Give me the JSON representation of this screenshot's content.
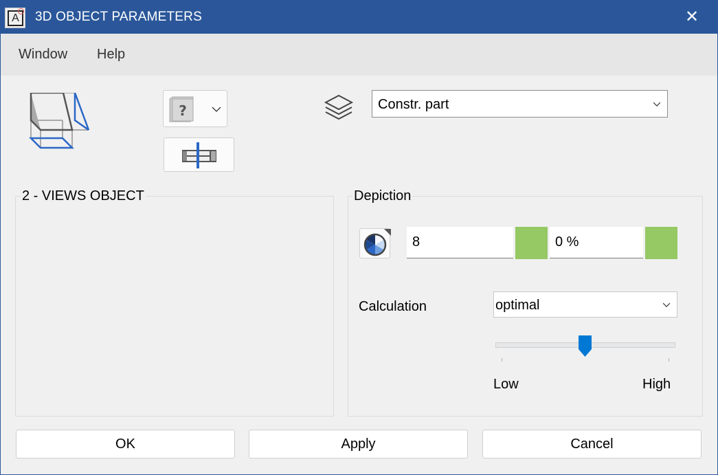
{
  "titlebar": {
    "title": "3D OBJECT PARAMETERS",
    "app_icon_letter": "A",
    "close_glyph": "✕"
  },
  "menu": {
    "items": [
      {
        "label": "Window"
      },
      {
        "label": "Help"
      }
    ]
  },
  "toolbar": {
    "unknown_type_glyph": "?",
    "layer_select": {
      "value": "Constr. part"
    }
  },
  "views_group": {
    "title": "2 - VIEWS OBJECT"
  },
  "depiction": {
    "title": "Depiction",
    "value_1": "8",
    "value_2": "0 %",
    "swatch_color": "#96c864",
    "calculation_label": "Calculation",
    "calculation_select": {
      "value": "optimal"
    },
    "slider": {
      "value_fraction": 0.5,
      "min_label": "Low",
      "max_label": "High"
    },
    "accent_color": "#0078d4"
  },
  "buttons": {
    "ok": "OK",
    "apply": "Apply",
    "cancel": "Cancel"
  }
}
